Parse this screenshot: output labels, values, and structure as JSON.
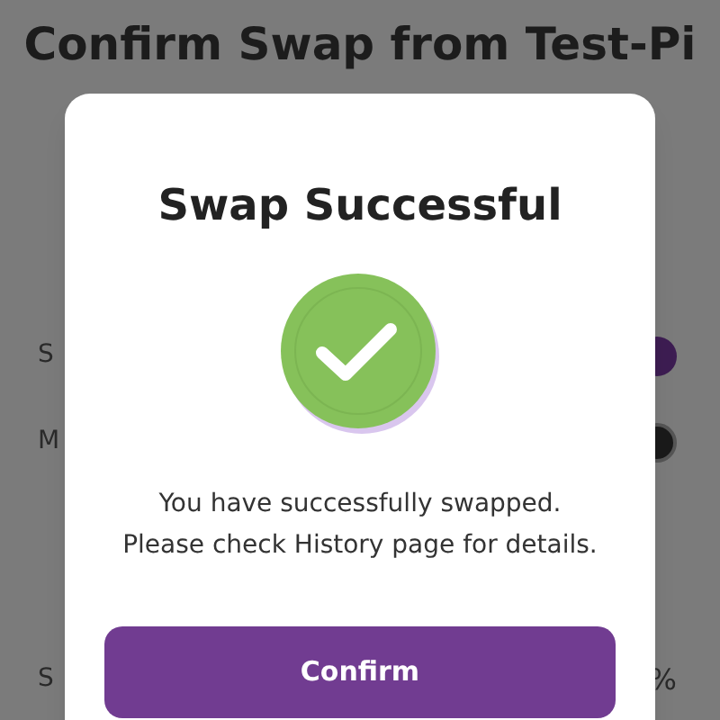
{
  "page": {
    "title": "Confirm Swap from Test-Pi",
    "rows": [
      {
        "label": "S",
        "kind": "token"
      },
      {
        "label": "M",
        "kind": "coin"
      },
      {
        "label": "S",
        "kind": "text",
        "value": "%"
      }
    ]
  },
  "dialog": {
    "title": "Swap Successful",
    "message_lines": [
      "You have successfully swapped.",
      "Please check History page for details."
    ],
    "button": "Confirm"
  }
}
